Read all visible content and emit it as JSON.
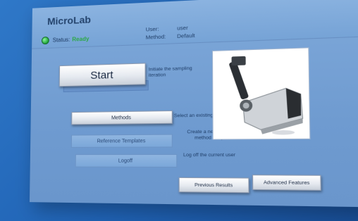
{
  "app": {
    "title": "MicroLab"
  },
  "status": {
    "label": "Status:",
    "value": "Ready",
    "led_color": "#2ba845"
  },
  "user": {
    "user_key": "User:",
    "user_value": "user",
    "method_key": "Method:",
    "method_value": "Default"
  },
  "buttons": {
    "start": "Start",
    "methods": "Methods",
    "reference_templates": "Reference Templates",
    "logoff": "Logoff",
    "previous_results": "Previous Results",
    "advanced_features": "Advanced Features"
  },
  "descriptions": {
    "start": "Initiate the sampling iteration",
    "methods": "Select an existing method",
    "reference_templates": "Create a new reference method template",
    "logoff": "Log off the current user"
  },
  "image": {
    "subject": "spectrometer-instrument"
  }
}
